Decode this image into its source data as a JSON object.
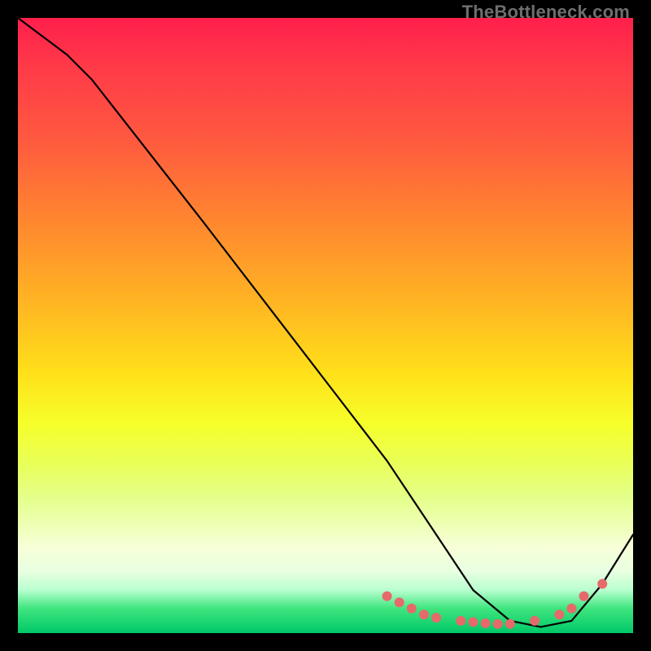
{
  "watermark": "TheBottleneck.com",
  "chart_data": {
    "type": "line",
    "title": "",
    "xlabel": "",
    "ylabel": "",
    "xlim": [
      0,
      100
    ],
    "ylim": [
      0,
      100
    ],
    "series": [
      {
        "name": "curve",
        "x": [
          0,
          8,
          12,
          30,
          50,
          60,
          68,
          74,
          80,
          85,
          90,
          95,
          100
        ],
        "y": [
          100,
          94,
          90,
          67,
          41,
          28,
          16,
          7,
          2,
          1,
          2,
          8,
          16
        ]
      }
    ],
    "markers": {
      "name": "dots",
      "x": [
        60,
        62,
        64,
        66,
        68,
        72,
        74,
        76,
        78,
        80,
        84,
        88,
        90,
        92,
        95
      ],
      "y": [
        6,
        5,
        4,
        3,
        2.5,
        2,
        1.8,
        1.6,
        1.5,
        1.5,
        2,
        3,
        4,
        6,
        8
      ],
      "color": "#e66a6a",
      "radius": 6
    },
    "gradient_stops": [
      {
        "pct": 0,
        "color": "#ff1f4c"
      },
      {
        "pct": 8,
        "color": "#ff3a48"
      },
      {
        "pct": 20,
        "color": "#ff5a3f"
      },
      {
        "pct": 34,
        "color": "#ff8a2e"
      },
      {
        "pct": 46,
        "color": "#ffb423"
      },
      {
        "pct": 58,
        "color": "#ffe11a"
      },
      {
        "pct": 66,
        "color": "#f6ff2a"
      },
      {
        "pct": 72,
        "color": "#eaff55"
      },
      {
        "pct": 78,
        "color": "#e4ff8a"
      },
      {
        "pct": 86,
        "color": "#f6ffd8"
      },
      {
        "pct": 90,
        "color": "#e8ffe0"
      },
      {
        "pct": 93,
        "color": "#b8ffcf"
      },
      {
        "pct": 96,
        "color": "#3fe57e"
      },
      {
        "pct": 100,
        "color": "#00c868"
      }
    ]
  }
}
